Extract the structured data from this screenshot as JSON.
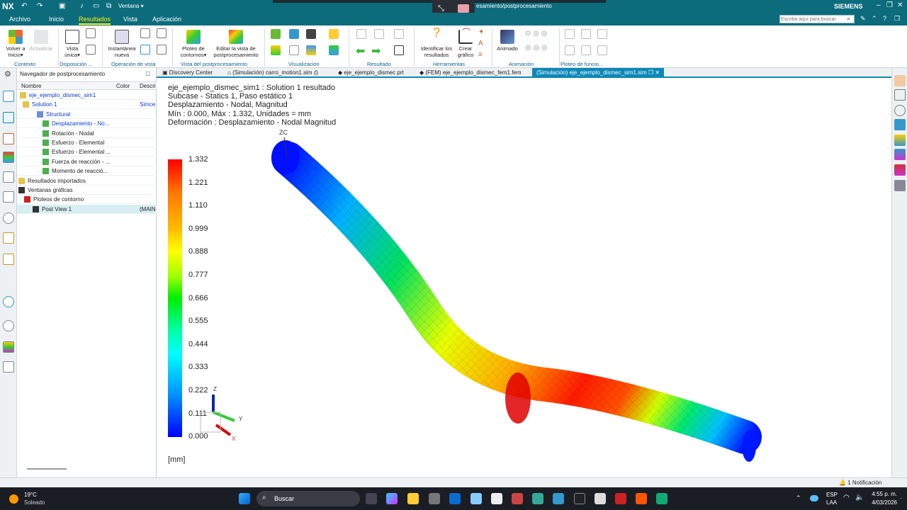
{
  "titlebar": {
    "app": "NX",
    "window_menu": "Ventana",
    "title": "esamiento/postprocesamiento",
    "brand": "SIEMENS",
    "search_placeholder": "Escriba aquí para buscar"
  },
  "menu": [
    "Archivo",
    "Inicio",
    "Resultados",
    "Vista",
    "Aplicación"
  ],
  "ribbon": {
    "buttons": [
      {
        "label": "Volver a\nInicio",
        "caret": "▾"
      },
      {
        "label": "Actualizar"
      },
      {
        "label": "Vista\núnica",
        "caret": "▾"
      },
      {
        "label": "Instantánea\nnueva"
      },
      {
        "label": "Ploteo de\ncontornos",
        "caret": "▾"
      },
      {
        "label": "Editar la vista de\npostprocesamiento"
      },
      {
        "label": "Identificar los\nresultados"
      },
      {
        "label": "Crear\ngráfico"
      },
      {
        "label": "Animado"
      }
    ],
    "groups": [
      "Contexto",
      "Disposición ...",
      "Operación de vista",
      "Vista del postprocesamiento",
      "Visualización",
      "Resultado",
      "Herramientas",
      "Animación",
      "Ploteo de funcio..."
    ]
  },
  "nav": {
    "title": "Navegador de postprocesamiento",
    "columns": [
      "Nombre",
      "Color",
      "Descri"
    ],
    "rows": [
      {
        "label": "eje_ejemplo_dismec_sim1",
        "desc": ""
      },
      {
        "label": "Solution 1",
        "desc": "Simce"
      },
      {
        "label": "Structural",
        "desc": ""
      },
      {
        "label": "Desplazamiento - No...",
        "desc": ""
      },
      {
        "label": "Rotación - Nodal",
        "desc": ""
      },
      {
        "label": "Esfuerzo - Elemental",
        "desc": ""
      },
      {
        "label": "Esfuerzo - Elemental ...",
        "desc": ""
      },
      {
        "label": "Fuerza de reacción - ...",
        "desc": ""
      },
      {
        "label": "Momento de reacció...",
        "desc": ""
      },
      {
        "label": "Resultados importados",
        "desc": ""
      },
      {
        "label": "Ventanas gráficas",
        "desc": ""
      },
      {
        "label": "Ploteos de contorno",
        "desc": ""
      },
      {
        "label": "Post View 1",
        "desc": "(MAIN"
      }
    ]
  },
  "tabs": [
    "Discovery Center",
    "(Simulación) carro_motion1.sim",
    "eje_ejemplo_dismec.prt",
    "(FEM) eje_ejemplo_dismec_fem1.fem",
    "(Simulación) eje_ejemplo_dismec_sim1.sim"
  ],
  "viewport": {
    "info": [
      "eje_ejemplo_dismec_sim1 : Solution 1 resultado",
      "Subcase - Statics 1, Paso estático 1",
      "Desplazamiento - Nodal, Magnitud",
      "Mín : 0.000, Máx : 1.332, Unidades = mm",
      "Deformación : Desplazamiento - Nodal Magnitud"
    ],
    "legend_values": [
      "1.332",
      "1.221",
      "1.110",
      "0.999",
      "0.888",
      "0.777",
      "0.666",
      "0.555",
      "0.444",
      "0.333",
      "0.222",
      "0.111",
      "0.000"
    ],
    "units": "[mm]",
    "zc_label": "ZC",
    "triad": {
      "z": "Z",
      "y": "Y",
      "x": "X"
    }
  },
  "status": {
    "notification": "1 Notificación"
  },
  "taskbar": {
    "temp": "19°C",
    "weather": "Soleado",
    "search": "Buscar",
    "lang1": "ESP",
    "lang2": "LAA",
    "time": "4:55 p. m.",
    "date": "4/03/2026"
  }
}
